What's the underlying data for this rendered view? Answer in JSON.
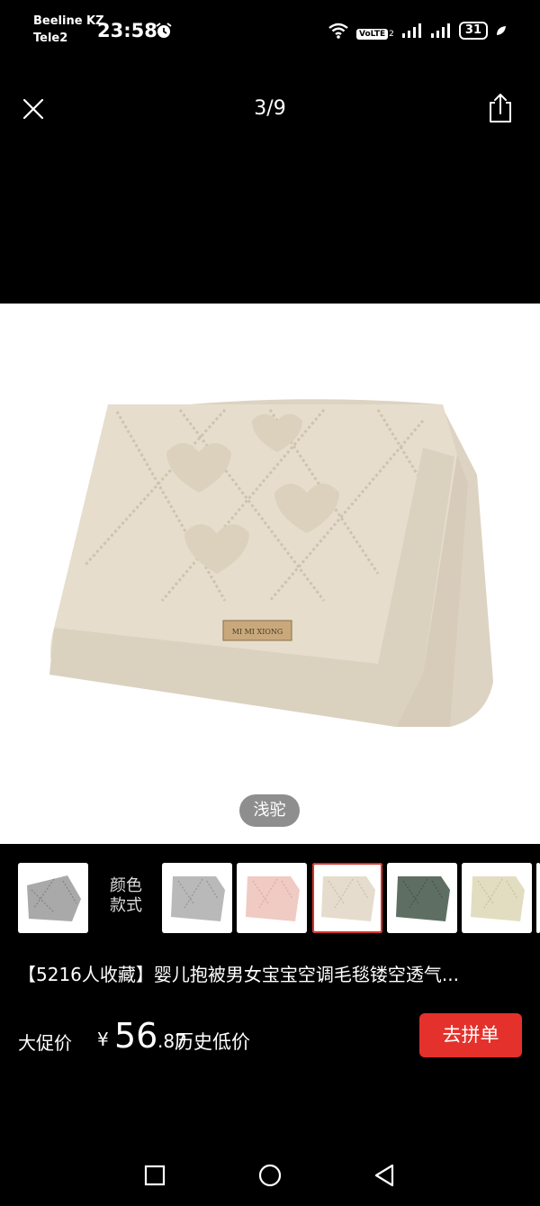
{
  "status_bar": {
    "carrier_1": "Beeline KZ",
    "carrier_2": "Tele2",
    "time": "23:58",
    "volte": "VoLTE",
    "volte_sub": "2",
    "battery": "31"
  },
  "viewer": {
    "counter": "3/9",
    "color_name": "浅驼"
  },
  "variants": {
    "style_label_line1": "颜色",
    "style_label_line2": "款式",
    "colors": [
      "#a9a9a9",
      "#b9b9b9",
      "#f0cbc3",
      "#e5dccd",
      "#5f6e63",
      "#e2ddc0",
      "#ffffff"
    ]
  },
  "product": {
    "title": "【5216人收藏】婴儿抱被男女宝宝空调毛毯镂空透气...",
    "price_label": "大促价",
    "currency": "¥",
    "price_int": "56",
    "price_dec": ".87",
    "price_note": "历史低价",
    "buy_button": "去拼单"
  },
  "colors": {
    "accent": "#e4312b",
    "selected_border": "#d8342b",
    "blanket": "#e5dccd"
  },
  "icons": [
    "close-icon",
    "share-icon",
    "alarm-icon",
    "wifi-icon",
    "signal-icon",
    "charging-icon",
    "recent-apps-icon",
    "home-icon",
    "back-icon"
  ]
}
